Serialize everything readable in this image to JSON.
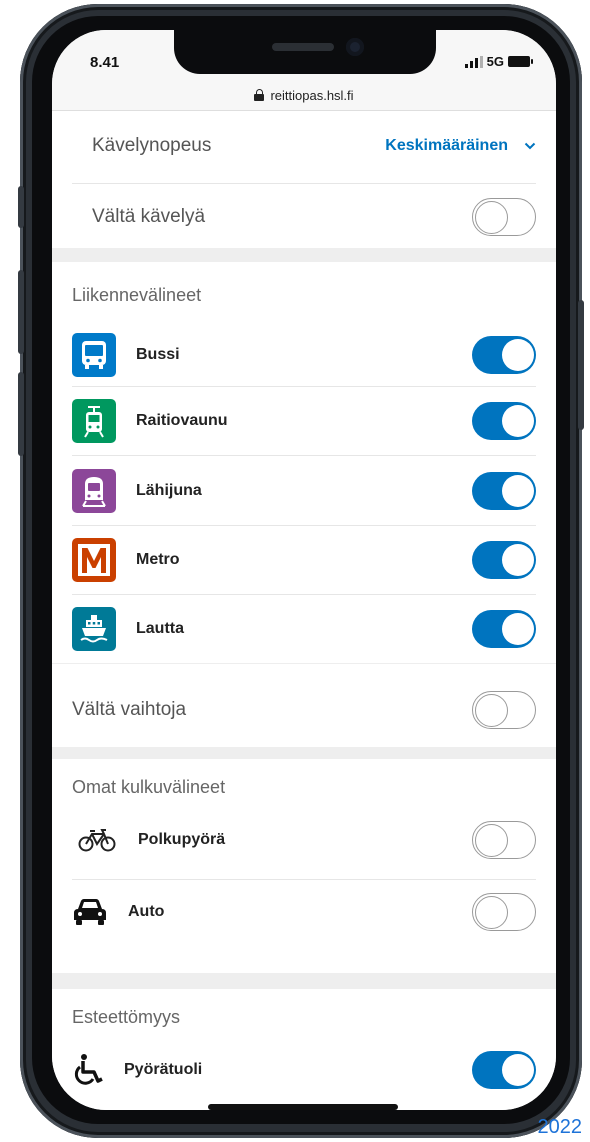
{
  "statusbar": {
    "time": "8.41",
    "network": "5G"
  },
  "browser": {
    "url": "reittiopas.hsl.fi"
  },
  "walking": {
    "speed_label": "Kävelynopeus",
    "speed_value": "Keskimääräinen",
    "avoid_label": "Vältä kävelyä",
    "avoid_on": false
  },
  "transport": {
    "header": "Liikennevälineet",
    "modes": [
      {
        "label": "Bussi",
        "icon": "bus-icon",
        "color": "#007AC9",
        "on": true
      },
      {
        "label": "Raitiovaunu",
        "icon": "tram-icon",
        "color": "#00985F",
        "on": true
      },
      {
        "label": "Lähijuna",
        "icon": "train-icon",
        "color": "#8C4799",
        "on": true
      },
      {
        "label": "Metro",
        "icon": "metro-icon",
        "color": "#CA4000",
        "on": true
      },
      {
        "label": "Lautta",
        "icon": "ferry-icon",
        "color": "#007A97",
        "on": true
      }
    ],
    "avoid_transfers_label": "Vältä vaihtoja",
    "avoid_transfers_on": false
  },
  "own_vehicles": {
    "header": "Omat kulkuvälineet",
    "items": [
      {
        "label": "Polkupyörä",
        "icon": "bicycle-icon",
        "on": false
      },
      {
        "label": "Auto",
        "icon": "car-icon",
        "on": false
      }
    ]
  },
  "accessibility": {
    "header": "Esteettömyys",
    "items": [
      {
        "label": "Pyörätuoli",
        "icon": "wheelchair-icon",
        "on": true
      }
    ]
  },
  "colors": {
    "accent": "#0074bf",
    "background": "#eeeeee"
  },
  "watermark": "2022"
}
